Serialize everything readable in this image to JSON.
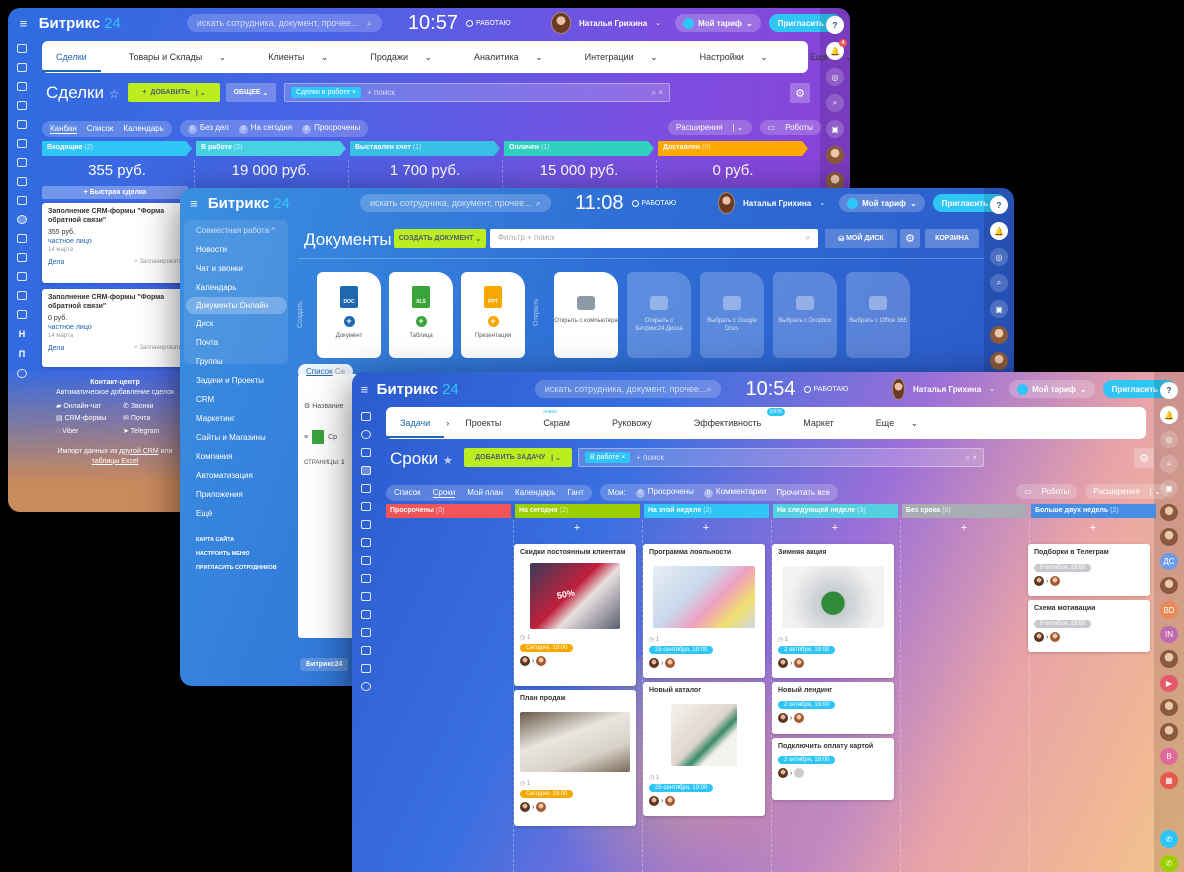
{
  "crm": {
    "logo_main": "Битрикс",
    "logo_num": "24",
    "search_placeholder": "искать сотрудника, документ, прочее...",
    "clock": "10:57",
    "work_status": "РАБОТАЮ",
    "user_name": "Наталья Грихина",
    "tariff": "Мой тариф",
    "invite": "Пригласить",
    "tabs": [
      "Сделки",
      "Товары и Склады",
      "Клиенты",
      "Продажи",
      "Аналитика",
      "Интеграции",
      "Настройки",
      "Еще"
    ],
    "page_title": "Сделки",
    "add_button": "ДОБАВИТЬ",
    "general_button": "ОБЩЕЕ",
    "filter_chip": "Сделки в работе",
    "filter_placeholder": "+ поиск",
    "views": [
      "Канбан",
      "Список",
      "Календарь"
    ],
    "counters": [
      "Без дел",
      "На сегодня",
      "Просрочены"
    ],
    "counter_values": [
      "0",
      "0",
      "0"
    ],
    "extensions": "Расширения",
    "robots": "Роботы",
    "stages": [
      {
        "name": "Входящие",
        "count": "(2)",
        "sum": "355 руб.",
        "color": "#2fc6f6"
      },
      {
        "name": "В работе",
        "count": "(2)",
        "sum": "19 000 руб.",
        "color": "#47d1e2"
      },
      {
        "name": "Выставлен счет",
        "count": "(1)",
        "sum": "1 700 руб.",
        "color": "#39c0e6"
      },
      {
        "name": "Оплачен",
        "count": "(1)",
        "sum": "15 000 руб.",
        "color": "#2fd1c0"
      },
      {
        "name": "Доставлен",
        "count": "(0)",
        "sum": "0 руб.",
        "color": "#ffa900"
      }
    ],
    "quick_deal": "+ Быстрая сделка",
    "cards": [
      {
        "title": "Заполнение CRM-формы \"Форма обратной связи\"",
        "price": "355 руб.",
        "contact": "частное лицо",
        "date": "14 марта",
        "deals": "Дела",
        "plan": "+ Запланировать"
      },
      {
        "title": "Заполнение CRM-формы \"Форма обратной связи\"",
        "price": "0 руб.",
        "contact": "частное лицо",
        "date": "14 марта",
        "deals": "Дела",
        "plan": "+ Запланировать"
      }
    ],
    "contact_center_title": "Контакт-центр",
    "contact_center_sub": "Автоматическое добавление сделок",
    "channels": [
      "Онлайн-чат",
      "Звонки",
      "CRM-формы",
      "Почта",
      "Viber",
      "Telegram"
    ],
    "import_text": "Импорт данных из",
    "import_link1": "другой CRM",
    "import_or": "или",
    "import_link2": "таблицы Excel"
  },
  "docs": {
    "logo_main": "Битрикс",
    "logo_num": "24",
    "search_placeholder": "искать сотрудника, документ, прочее...",
    "clock": "11:08",
    "work_status": "РАБОТАЮ",
    "user_name": "Наталья Грихина",
    "tariff": "Мой тариф",
    "invite": "Пригласить",
    "nav": [
      "Совместная работа ^",
      "Новости",
      "Чат и звонки",
      "Календарь",
      "Документы Онлайн",
      "Диск",
      "Почта",
      "Группы",
      "Задачи и Проекты",
      "CRM",
      "Маркетинг",
      "Сайты и Магазины",
      "Компания",
      "Автоматизация",
      "Приложения",
      "Ещё"
    ],
    "nav_small": [
      "КАРТА САЙТА",
      "НАСТРОИТЬ МЕНЮ",
      "ПРИГЛАСИТЬ СОТРУДНИКОВ"
    ],
    "page_title": "Документы",
    "create_button": "СОЗДАТЬ ДОКУМЕНТ",
    "filter_placeholder": "Фильтр + поиск",
    "my_disk": "МОЙ ДИСК",
    "trash": "КОРЗИНА",
    "create_label": "Создать",
    "open_label": "Открыть",
    "create_items": [
      {
        "ext": "DOC",
        "label": "Документ",
        "color": "#2067b0"
      },
      {
        "ext": "XLS",
        "label": "Таблица",
        "color": "#3aa33a"
      },
      {
        "ext": "PPT",
        "label": "Презентация",
        "color": "#f7a700"
      }
    ],
    "open_items": [
      "Открыть с компьютера",
      "Открыть с Битрикс24.Диска",
      "Выбрать с Google Docs",
      "Выбрать с Dropbox",
      "Выбрать с Office 365"
    ],
    "list_tab": "Список",
    "list_tab2": "Се",
    "col_name": "Название",
    "row_name": "Ср",
    "pages_label": "СТРАНИЦЫ:",
    "pages_value": "1",
    "footer_logo": "Битрикс24"
  },
  "tasks": {
    "logo_main": "Битрикс",
    "logo_num": "24",
    "search_placeholder": "искать сотрудника, документ, прочее...",
    "clock": "10:54",
    "work_status": "РАБОТАЮ",
    "user_name": "Наталья Грихина",
    "tariff": "Мой тариф",
    "invite": "Пригласить",
    "tabs": [
      "Задачи",
      "Проекты",
      "Скрам",
      "Руковожу",
      "Эффективность",
      "Маркет",
      "Еще"
    ],
    "new_badge": "новое",
    "eff_badge": "100%",
    "page_title": "Сроки",
    "add_button": "ДОБАВИТЬ ЗАДАЧУ",
    "filter_chip": "В работе",
    "filter_placeholder": "+ поиск",
    "views": [
      "Список",
      "Сроки",
      "Мой план",
      "Календарь",
      "Гант"
    ],
    "my_label": "Мои:",
    "counters": [
      "Просрочены",
      "Комментарии",
      "Прочитать все"
    ],
    "counter_values": [
      "0",
      "0"
    ],
    "robots": "Роботы",
    "extensions": "Расширения",
    "columns": [
      {
        "name": "Просрочены",
        "count": "(0)",
        "color": "#f1555a"
      },
      {
        "name": "На сегодня",
        "count": "(2)",
        "color": "#9dcf00"
      },
      {
        "name": "На этой неделе",
        "count": "(2)",
        "color": "#2fc6f6"
      },
      {
        "name": "На следующей неделе",
        "count": "(3)",
        "color": "#55d0e0"
      },
      {
        "name": "Без срока",
        "count": "(0)",
        "color": "#a8adb4"
      },
      {
        "name": "Больше двух недель",
        "count": "(2)",
        "color": "#468ee5"
      }
    ],
    "cards": [
      {
        "title": "Скидки постоянным клиентам",
        "check": "1",
        "date": "Сегодня, 19:00",
        "date_color": "#f7a700"
      },
      {
        "title": "План продаж",
        "check": "1",
        "date": "Сегодня, 19:00",
        "date_color": "#f7a700"
      },
      {
        "title": "Программа лояльности",
        "check": "1",
        "date": "25 сентября, 19:00",
        "date_color": "#2fc6f6"
      },
      {
        "title": "Новый каталог",
        "check": "1",
        "date": "25 сентября, 19:00",
        "date_color": "#2fc6f6"
      },
      {
        "title": "Зимняя акция",
        "check": "1",
        "date": "2 октября, 19:00",
        "date_color": "#2fc6f6"
      },
      {
        "title": "Новый лендинг",
        "date": "2 октября, 19:00",
        "date_color": "#2fc6f6"
      },
      {
        "title": "Подключить оплату картой",
        "date": "2 октября, 19:00",
        "date_color": "#2fc6f6"
      },
      {
        "title": "Подборки в Телеграм",
        "date": "9 октября, 19:00",
        "date_color": "#c5c9ce"
      },
      {
        "title": "Схема мотивации",
        "date": "9 октября, 19:00",
        "date_color": "#c5c9ce"
      }
    ],
    "discount_text": "50%"
  },
  "sidebar_letters": [
    "H",
    "П"
  ],
  "right_letters": [
    "ДС",
    "BD",
    "IN",
    "B"
  ],
  "notif_count": "4"
}
